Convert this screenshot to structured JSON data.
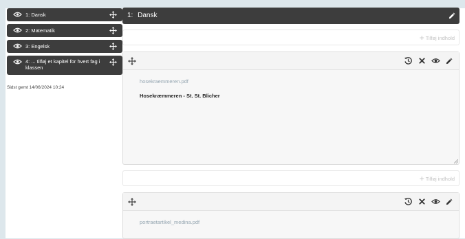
{
  "sidebar": {
    "chapters": [
      {
        "label": "1: Dansk"
      },
      {
        "label": "2: Matematik"
      },
      {
        "label": "3: Engelsk"
      },
      {
        "label": "4: ... tilføj et kapitel for hvert fag i klassen"
      }
    ],
    "last_saved": "Sidst gemt 14/06/2024 10:24"
  },
  "main": {
    "header": {
      "number": "1:",
      "title": "Dansk"
    },
    "add_content_label": "Tilføj indhold",
    "cards": [
      {
        "filename": "hosekraemmeren.pdf",
        "title": "Hosekræmmeren - St. St. Blicher"
      },
      {
        "filename": "portraetartikel_medina.pdf",
        "title": ""
      }
    ]
  },
  "icons": [
    "eye-icon",
    "move-icon",
    "pencil-icon",
    "history-icon",
    "close-icon",
    "plus-icon",
    "resize-handle-icon"
  ],
  "colors": {
    "dark": "#3d3d3d",
    "background": "#dde7ec",
    "filename": "#95a6b1"
  }
}
